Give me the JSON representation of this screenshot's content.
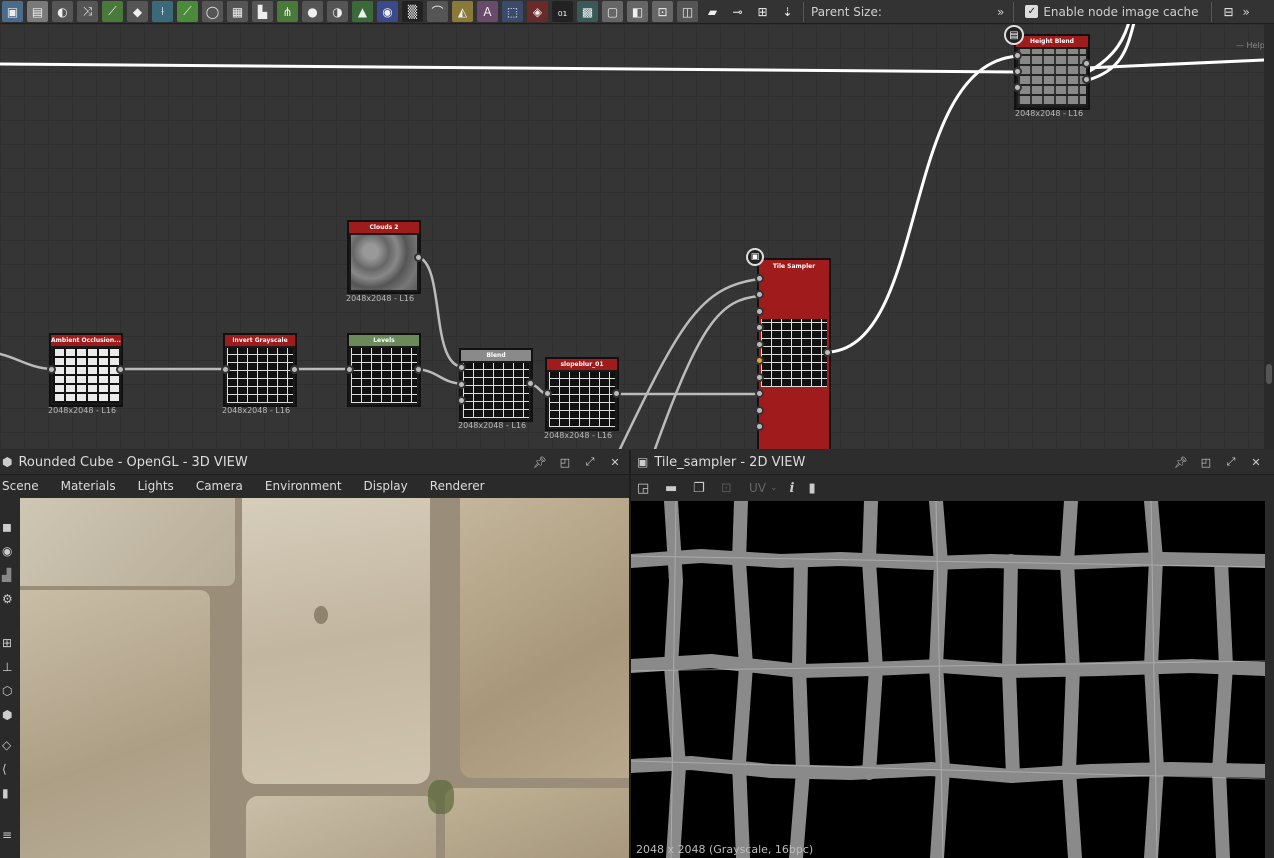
{
  "toolbar": {
    "parent_size_label": "Parent Size:",
    "parent_size_chevron": "»",
    "cache_label": "Enable node image cache",
    "cache_checked": true,
    "more_chevron": "»"
  },
  "graph": {
    "nodes": {
      "ambient": {
        "title": "Ambient Occlusion...",
        "size": "2048x2048 - L16"
      },
      "invert": {
        "title": "Invert Grayscale",
        "size": "2048x2048 - L16"
      },
      "clouds": {
        "title": "Clouds 2",
        "size": "2048x2048 - L16"
      },
      "levels": {
        "title": "Levels",
        "size": ""
      },
      "blend": {
        "title": "Blend",
        "size": "2048x2048 - L16"
      },
      "slopeblur": {
        "title": "slopeblur_01",
        "size": "2048x2048 - L16"
      },
      "tile_sampler": {
        "title": "Tile Sampler",
        "size": ""
      },
      "height_blend": {
        "title": "Height Blend",
        "size": "2048x2048 - L16"
      }
    },
    "help_text": "— Help"
  },
  "view3d": {
    "title": "Rounded Cube - OpenGL - 3D VIEW",
    "menu": [
      "Scene",
      "Materials",
      "Lights",
      "Camera",
      "Environment",
      "Display",
      "Renderer"
    ]
  },
  "view2d": {
    "title": "Tile_sampler - 2D VIEW",
    "uv_label": "UV",
    "info_label": "i",
    "status": "2048 x 2048 (Grayscale, 16bpc)"
  },
  "colors": {
    "node_red": "#a01c1c",
    "node_gray": "#8a8a8a",
    "node_green": "#6a8a5a",
    "node_dark_red": "#8b1e1e"
  }
}
